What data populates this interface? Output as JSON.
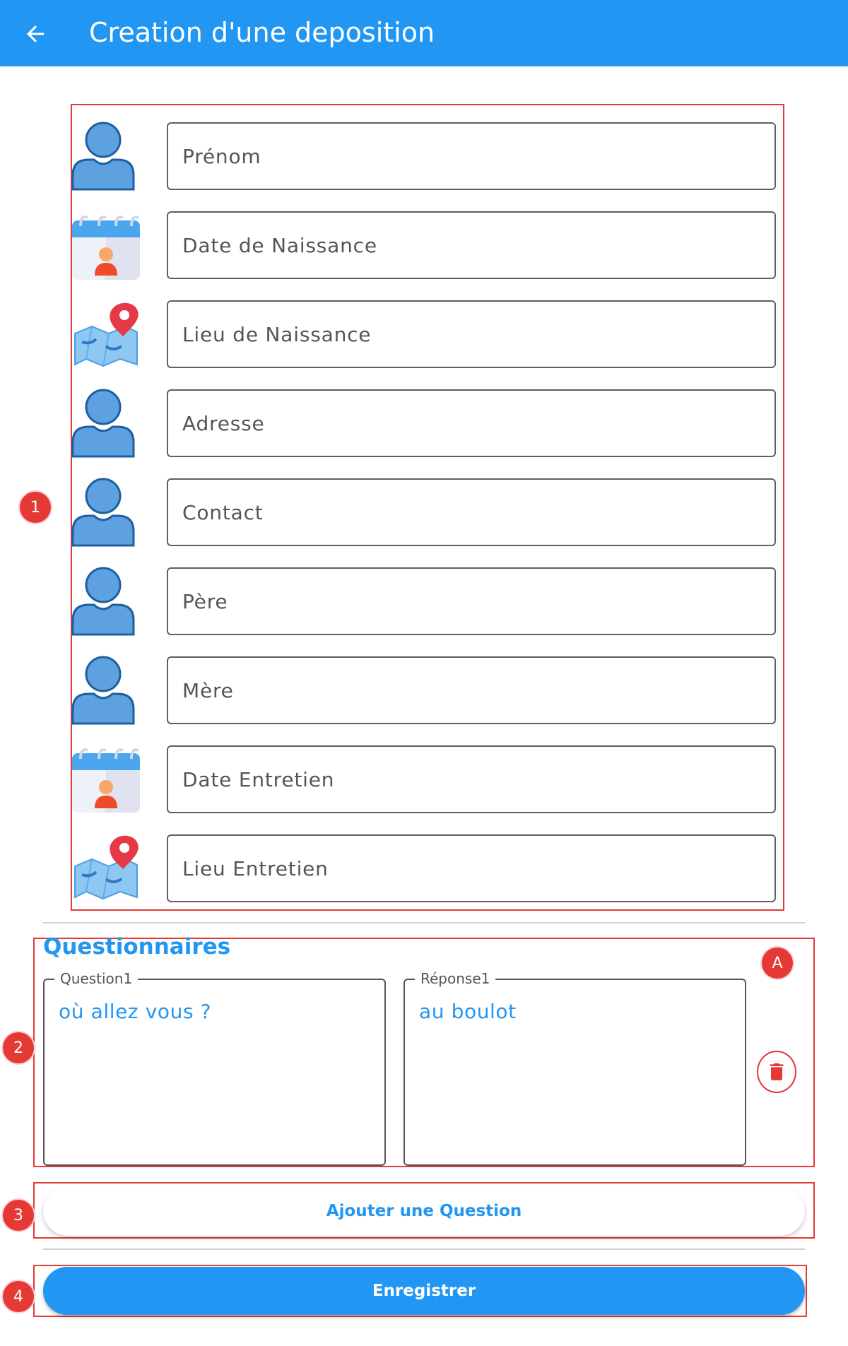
{
  "app_bar": {
    "title": "Creation d'une deposition",
    "back_icon": "arrow-left-icon",
    "color": "#2196f3"
  },
  "form": {
    "fields": [
      {
        "placeholder": "Prénom",
        "icon": "person-icon"
      },
      {
        "placeholder": "Date de Naissance",
        "icon": "calendar-person-icon"
      },
      {
        "placeholder": "Lieu de Naissance",
        "icon": "map-pin-icon"
      },
      {
        "placeholder": "Adresse",
        "icon": "person-icon"
      },
      {
        "placeholder": "Contact",
        "icon": "person-icon"
      },
      {
        "placeholder": "Père",
        "icon": "person-icon"
      },
      {
        "placeholder": "Mère",
        "icon": "person-icon"
      },
      {
        "placeholder": "Date Entretien",
        "icon": "calendar-person-icon"
      },
      {
        "placeholder": "Lieu Entretien",
        "icon": "map-pin-icon"
      }
    ]
  },
  "questionnaire": {
    "title": "Questionnaires",
    "question_label": "Question1",
    "question_value": "où allez vous ?",
    "answer_label": "Réponse1",
    "answer_value": "au boulot",
    "delete_icon": "trash-icon"
  },
  "actions": {
    "add_question_label": "Ajouter une Question",
    "save_label": "Enregistrer"
  },
  "annotations": {
    "badge_1": "1",
    "badge_2": "2",
    "badge_3": "3",
    "badge_4": "4",
    "badge_a": "A",
    "color": "#e53935"
  }
}
